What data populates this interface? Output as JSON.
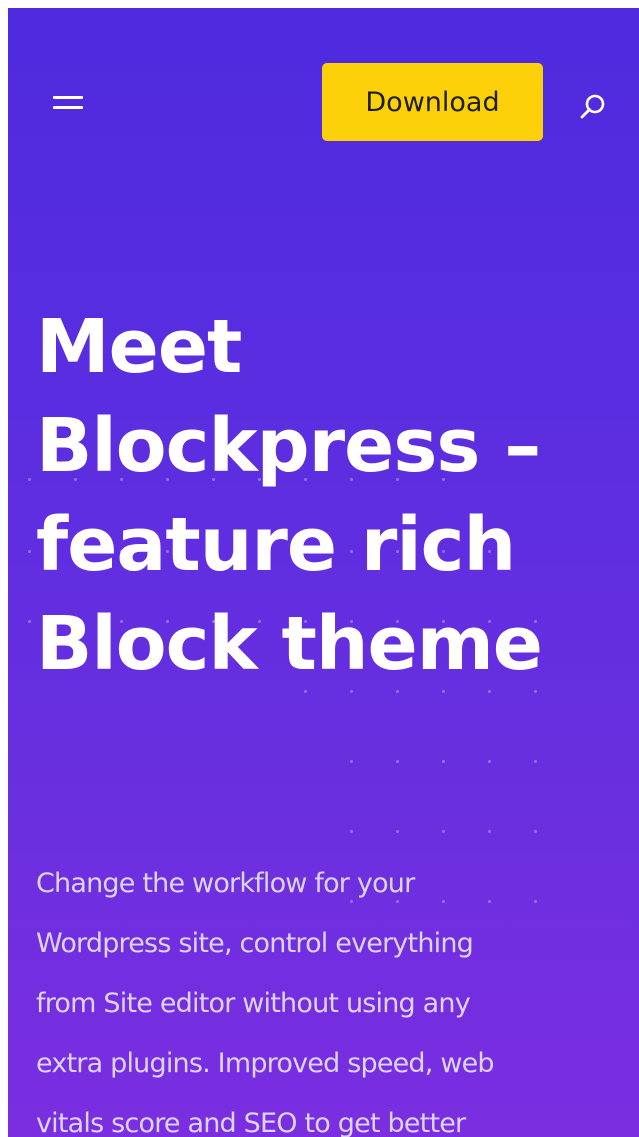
{
  "header": {
    "menu_icon": "hamburger-menu-icon",
    "download_label": "Download",
    "search_icon": "search-icon",
    "download_color": "#fdd10a"
  },
  "hero": {
    "title_lines": [
      "Meet",
      "Blockpress –",
      "feature rich",
      "Block theme"
    ],
    "subtitle_lines": [
      "Change the workflow for your",
      "Wordpress site, control everything",
      "from Site editor without using any",
      "extra plugins. Improved speed, web",
      "vitals score and SEO to get better"
    ]
  },
  "colors": {
    "background_top": "#4f2ade",
    "background_bottom": "#7a2ee0",
    "text": "#ffffff"
  }
}
